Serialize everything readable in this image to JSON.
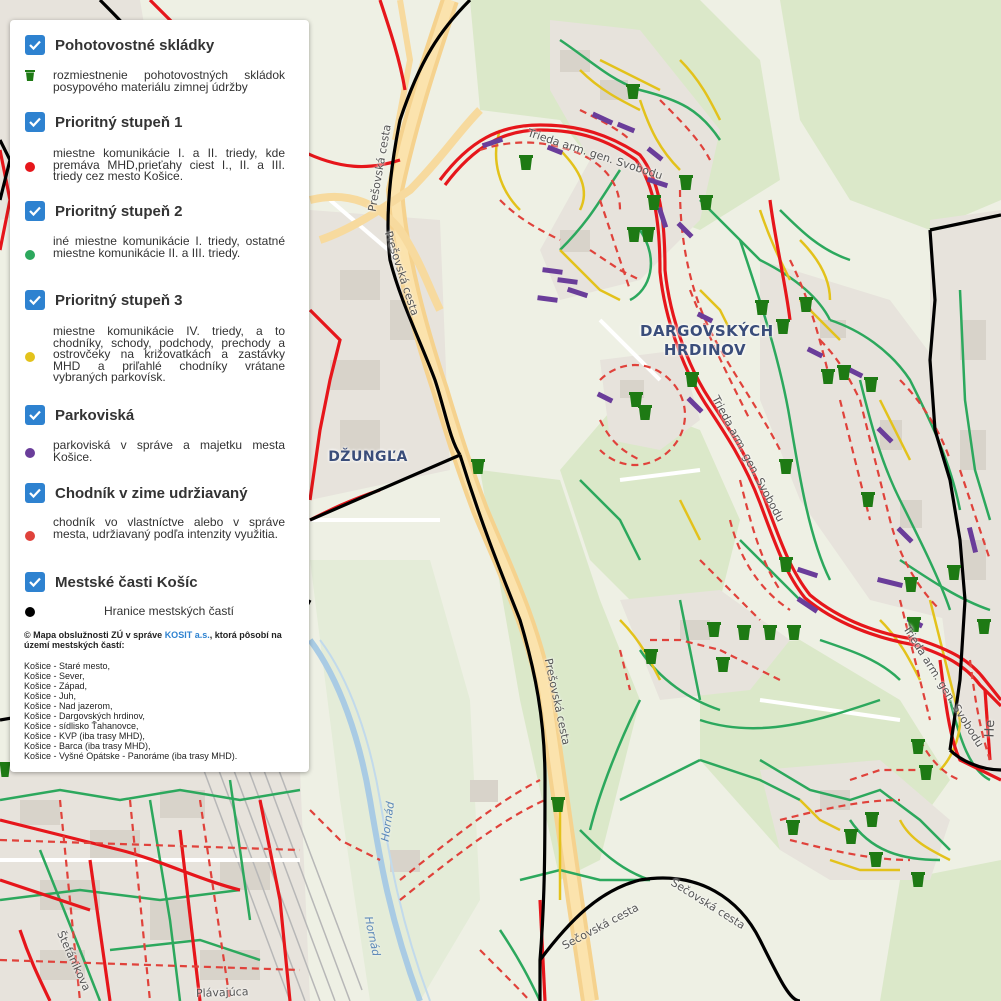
{
  "map": {
    "district_labels": [
      {
        "id": "dargovskych",
        "line1": "DARGOVSKÝCH",
        "line2": "HRDINOV"
      },
      {
        "id": "dzungla",
        "line1": "DŽUNGĽA",
        "line2": ""
      }
    ],
    "street_labels": {
      "presovska_1": "Prešovská cesta",
      "presovska_2": "Prešovská cesta",
      "presovska_3": "Prešovská cesta",
      "trieda_1": "Trieda arm. gen. Svobodu",
      "trieda_2": "Trieda arm. gen. Svobodu",
      "trieda_3": "Trieda arm. gen. Svobodu",
      "secovska_1": "Sečovská cesta",
      "secovska_2": "Sečovská cesta",
      "hornad_1": "Hornád",
      "hornad_2": "Hornád",
      "stefanikova": "Štefánikova",
      "plavajuca": "Plávajúca",
      "partial_he": "He"
    },
    "colors": {
      "priority1": "#e6161b",
      "priority2": "#2ca85d",
      "priority3": "#e3c21b",
      "parking": "#6a3d9a",
      "sidewalk": "#e0423b",
      "boundary": "#000000",
      "depot": "#1e7a14"
    }
  },
  "legend": {
    "sections": [
      {
        "title": "Pohotovostné skládky",
        "checked": true,
        "icon": "trash-bin-icon",
        "desc": "rozmiestnenie pohotovostných skládok posypového materiálu zimnej údržby"
      },
      {
        "title": "Prioritný stupeň 1",
        "checked": true,
        "color": "#e6161b",
        "desc": "miestne komunikácie I. a II. triedy, kde premáva MHD,prieťahy ciest I., II. a III. triedy cez mesto Košice."
      },
      {
        "title": "Prioritný stupeň 2",
        "checked": true,
        "color": "#2ca85d",
        "desc": "iné miestne komunikácie I. triedy, ostatné miestne komunikácie II. a III. triedy."
      },
      {
        "title": "Prioritný stupeň 3",
        "checked": true,
        "color": "#e3c21b",
        "desc": "miestne komunikácie IV. triedy, a to chodníky, schody, podchody, prechody a ostrovčeky na križovatkách a zastávky MHD a priľahlé chodníky vrátane vybraných parkovísk."
      },
      {
        "title": "Parkoviská",
        "checked": true,
        "color": "#6a3d9a",
        "desc": "parkoviská v správe a majetku mesta Košice."
      },
      {
        "title": "Chodník v zime udržiavaný",
        "checked": true,
        "color": "#e0423b",
        "desc": "chodník vo vlastníctve alebo v správe mesta, udržiavaný podľa intenzity využitia."
      },
      {
        "title": "Mestské časti Košíc",
        "checked": true,
        "color": "#000000",
        "desc": "Hranice mestských častí"
      }
    ],
    "copyright_prefix": "© Mapa obslužnosti ZÚ v správe",
    "copyright_link": "KOSIT a.s.",
    "copyright_suffix": ", ktorá pôsobí na území mestských častí:",
    "districts": [
      "Košice - Staré mesto,",
      "Košice - Sever,",
      "Košice - Západ,",
      "Košice - Juh,",
      "Košice - Nad jazerom,",
      "Košice - Dargovských hrdinov,",
      "Košice - sídlisko Ťahanovce,",
      "Košice - KVP (iba trasy MHD),",
      "Košice - Barca (iba trasy MHD),",
      "Košice - Vyšné Opátske - Panoráme (iba trasy MHD)."
    ]
  }
}
